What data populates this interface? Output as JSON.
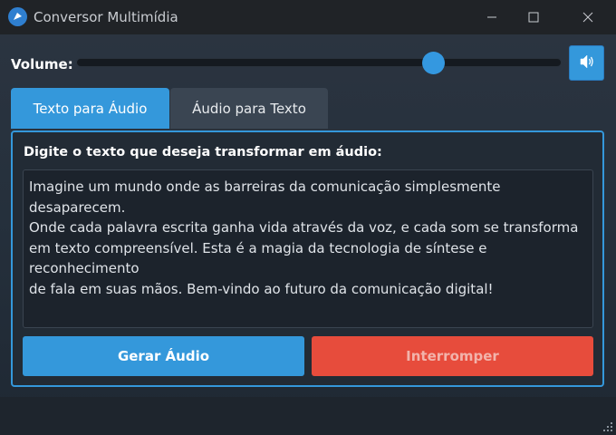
{
  "window": {
    "title": "Conversor Multimídia"
  },
  "volume": {
    "label": "Volume:",
    "level_percent": 74
  },
  "tabs": [
    {
      "label": "Texto para Áudio",
      "active": true
    },
    {
      "label": "Áudio para Texto",
      "active": false
    }
  ],
  "panel": {
    "label": "Digite o texto que deseja transformar em áudio:",
    "text": "Imagine um mundo onde as barreiras da comunicação simplesmente desaparecem.\nOnde cada palavra escrita ganha vida através da voz, e cada som se transforma\nem texto compreensível. Esta é a magia da tecnologia de síntese e reconhecimento\nde fala em suas mãos. Bem-vindo ao futuro da comunicação digital!"
  },
  "buttons": {
    "generate": "Gerar Áudio",
    "stop": "Interromper"
  },
  "colors": {
    "accent": "#3498db",
    "danger": "#e74c3c"
  },
  "icons": {
    "app": "app-logo-icon",
    "speaker": "speaker-icon"
  }
}
